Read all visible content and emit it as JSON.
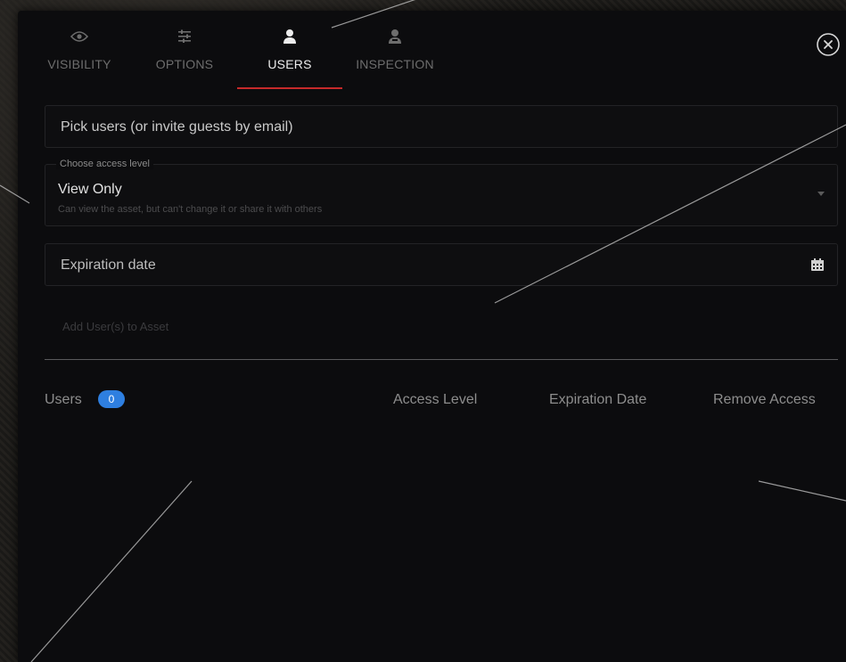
{
  "tabs": [
    {
      "label": "VISIBILITY",
      "icon": "eye-icon",
      "active": false
    },
    {
      "label": "OPTIONS",
      "icon": "sliders-icon",
      "active": false
    },
    {
      "label": "USERS",
      "icon": "user-icon",
      "active": true
    },
    {
      "label": "INSPECTION",
      "icon": "user-badge-icon",
      "active": false
    }
  ],
  "close_icon": "close-icon",
  "pick_users": {
    "placeholder": "Pick users (or invite guests by email)"
  },
  "access_level": {
    "legend": "Choose access level",
    "value": "View Only",
    "description": "Can view the asset, but can't change it or share it with others"
  },
  "expiration": {
    "placeholder": "Expiration date",
    "icon": "calendar-icon"
  },
  "add_users_label": "Add User(s) to Asset",
  "users_table": {
    "users_label": "Users",
    "users_count": "0",
    "columns": [
      "Access Level",
      "Expiration Date",
      "Remove Access"
    ]
  },
  "colors": {
    "accent_underline": "#c62a2a",
    "badge": "#2e7fe0",
    "panel_bg": "#0c0c0e"
  }
}
